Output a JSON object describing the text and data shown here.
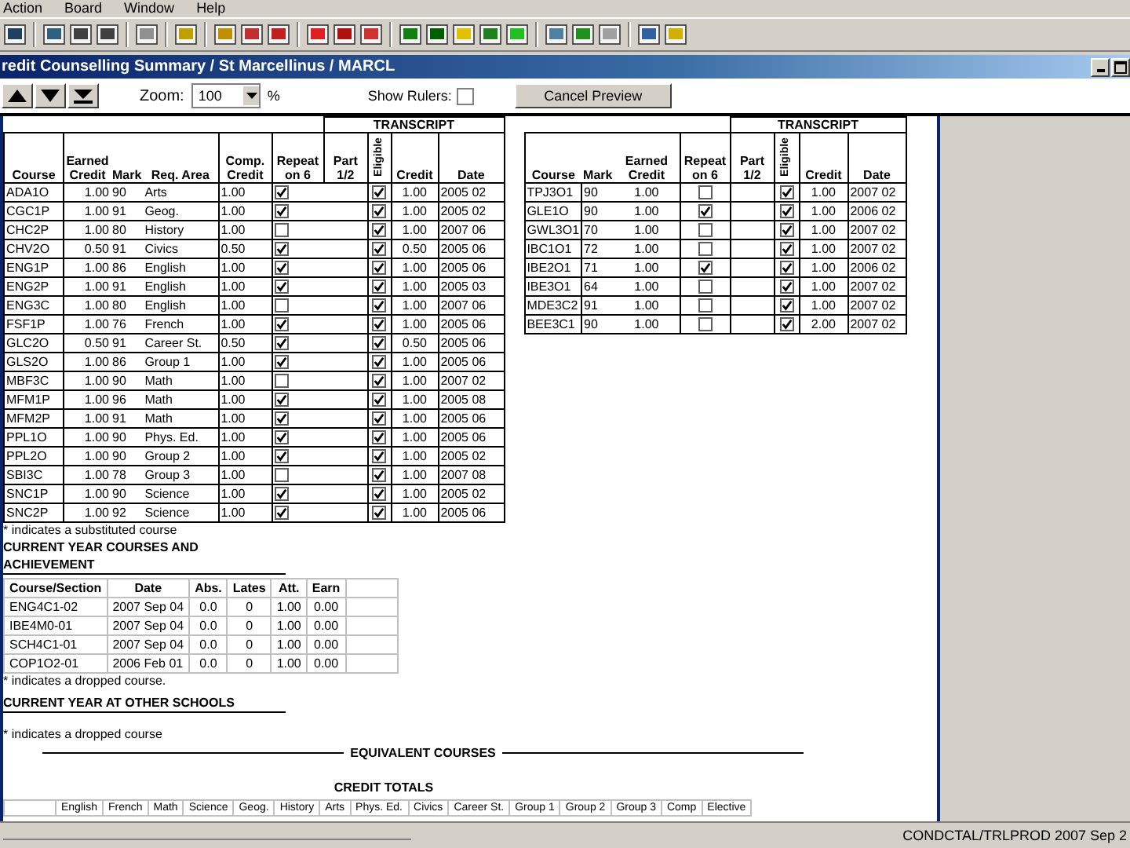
{
  "menu": [
    "Action",
    "Board",
    "Window",
    "Help"
  ],
  "window": {
    "title": "redit Counselling Summary  / St Marcellinus / MARCL"
  },
  "preview_toolbar": {
    "zoom_label": "Zoom:",
    "zoom_value": "100",
    "zoom_unit": "%",
    "show_rulers_label": "Show Rulers:",
    "show_rulers_checked": false,
    "cancel_button": "Cancel Preview"
  },
  "transcript_left": {
    "group_label": "TRANSCRIPT",
    "columns": [
      "Course",
      "Earned Credit",
      "Mark",
      "Req. Area",
      "Comp. Credit",
      "Repeat on 6",
      "Part 1/2",
      "Eligible",
      "Credit",
      "Date"
    ],
    "rows": [
      {
        "course": "ADA1O",
        "earned_credit": "1.00",
        "mark": "90",
        "req_area": "Arts",
        "comp_credit": "1.00",
        "repeat_on_6": true,
        "eligible": true,
        "credit": "1.00",
        "date": "2005 02"
      },
      {
        "course": "CGC1P",
        "earned_credit": "1.00",
        "mark": "91",
        "req_area": "Geog.",
        "comp_credit": "1.00",
        "repeat_on_6": true,
        "eligible": true,
        "credit": "1.00",
        "date": "2005 02"
      },
      {
        "course": "CHC2P",
        "earned_credit": "1.00",
        "mark": "80",
        "req_area": "History",
        "comp_credit": "1.00",
        "repeat_on_6": false,
        "eligible": true,
        "credit": "1.00",
        "date": "2007 06"
      },
      {
        "course": "CHV2O",
        "earned_credit": "0.50",
        "mark": "91",
        "req_area": "Civics",
        "comp_credit": "0.50",
        "repeat_on_6": true,
        "eligible": true,
        "credit": "0.50",
        "date": "2005 06"
      },
      {
        "course": "ENG1P",
        "earned_credit": "1.00",
        "mark": "86",
        "req_area": "English",
        "comp_credit": "1.00",
        "repeat_on_6": true,
        "eligible": true,
        "credit": "1.00",
        "date": "2005 06"
      },
      {
        "course": "ENG2P",
        "earned_credit": "1.00",
        "mark": "91",
        "req_area": "English",
        "comp_credit": "1.00",
        "repeat_on_6": true,
        "eligible": true,
        "credit": "1.00",
        "date": "2005 03"
      },
      {
        "course": "ENG3C",
        "earned_credit": "1.00",
        "mark": "80",
        "req_area": "English",
        "comp_credit": "1.00",
        "repeat_on_6": false,
        "eligible": true,
        "credit": "1.00",
        "date": "2007 06"
      },
      {
        "course": "FSF1P",
        "earned_credit": "1.00",
        "mark": "76",
        "req_area": "French",
        "comp_credit": "1.00",
        "repeat_on_6": true,
        "eligible": true,
        "credit": "1.00",
        "date": "2005 06"
      },
      {
        "course": "GLC2O",
        "earned_credit": "0.50",
        "mark": "91",
        "req_area": "Career St.",
        "comp_credit": "0.50",
        "repeat_on_6": true,
        "eligible": true,
        "credit": "0.50",
        "date": "2005 06"
      },
      {
        "course": "GLS2O",
        "earned_credit": "1.00",
        "mark": "86",
        "req_area": "Group 1",
        "comp_credit": "1.00",
        "repeat_on_6": true,
        "eligible": true,
        "credit": "1.00",
        "date": "2005 06"
      },
      {
        "course": "MBF3C",
        "earned_credit": "1.00",
        "mark": "90",
        "req_area": "Math",
        "comp_credit": "1.00",
        "repeat_on_6": false,
        "eligible": true,
        "credit": "1.00",
        "date": "2007 02"
      },
      {
        "course": "MFM1P",
        "earned_credit": "1.00",
        "mark": "96",
        "req_area": "Math",
        "comp_credit": "1.00",
        "repeat_on_6": true,
        "eligible": true,
        "credit": "1.00",
        "date": "2005 08"
      },
      {
        "course": "MFM2P",
        "earned_credit": "1.00",
        "mark": "91",
        "req_area": "Math",
        "comp_credit": "1.00",
        "repeat_on_6": true,
        "eligible": true,
        "credit": "1.00",
        "date": "2005 06"
      },
      {
        "course": "PPL1O",
        "earned_credit": "1.00",
        "mark": "90",
        "req_area": "Phys. Ed.",
        "comp_credit": "1.00",
        "repeat_on_6": true,
        "eligible": true,
        "credit": "1.00",
        "date": "2005 06"
      },
      {
        "course": "PPL2O",
        "earned_credit": "1.00",
        "mark": "90",
        "req_area": "Group 2",
        "comp_credit": "1.00",
        "repeat_on_6": true,
        "eligible": true,
        "credit": "1.00",
        "date": "2005 02"
      },
      {
        "course": "SBI3C",
        "earned_credit": "1.00",
        "mark": "78",
        "req_area": "Group 3",
        "comp_credit": "1.00",
        "repeat_on_6": false,
        "eligible": true,
        "credit": "1.00",
        "date": "2007 08"
      },
      {
        "course": "SNC1P",
        "earned_credit": "1.00",
        "mark": "90",
        "req_area": "Science",
        "comp_credit": "1.00",
        "repeat_on_6": true,
        "eligible": true,
        "credit": "1.00",
        "date": "2005 02"
      },
      {
        "course": "SNC2P",
        "earned_credit": "1.00",
        "mark": "92",
        "req_area": "Science",
        "comp_credit": "1.00",
        "repeat_on_6": true,
        "eligible": true,
        "credit": "1.00",
        "date": "2005 06"
      }
    ]
  },
  "transcript_right": {
    "group_label": "TRANSCRIPT",
    "columns": [
      "Course",
      "Mark",
      "Earned Credit",
      "Repeat on 6",
      "Part 1/2",
      "Eligible",
      "Credit",
      "Date"
    ],
    "rows": [
      {
        "course": "TPJ3O1",
        "mark": "90",
        "earned_credit": "1.00",
        "repeat_on_6": false,
        "eligible": true,
        "credit": "1.00",
        "date": "2007 02"
      },
      {
        "course": "GLE1O",
        "mark": "90",
        "earned_credit": "1.00",
        "repeat_on_6": true,
        "eligible": true,
        "credit": "1.00",
        "date": "2006 02"
      },
      {
        "course": "GWL3O1",
        "mark": "70",
        "earned_credit": "1.00",
        "repeat_on_6": false,
        "eligible": true,
        "credit": "1.00",
        "date": "2007 02"
      },
      {
        "course": "IBC1O1",
        "mark": "72",
        "earned_credit": "1.00",
        "repeat_on_6": false,
        "eligible": true,
        "credit": "1.00",
        "date": "2007 02"
      },
      {
        "course": "IBE2O1",
        "mark": "71",
        "earned_credit": "1.00",
        "repeat_on_6": true,
        "eligible": true,
        "credit": "1.00",
        "date": "2006 02"
      },
      {
        "course": "IBE3O1",
        "mark": "64",
        "earned_credit": "1.00",
        "repeat_on_6": false,
        "eligible": true,
        "credit": "1.00",
        "date": "2007 02"
      },
      {
        "course": "MDE3C2",
        "mark": "91",
        "earned_credit": "1.00",
        "repeat_on_6": false,
        "eligible": true,
        "credit": "1.00",
        "date": "2007 02"
      },
      {
        "course": "BEE3C1",
        "mark": "90",
        "earned_credit": "1.00",
        "repeat_on_6": false,
        "eligible": true,
        "credit": "2.00",
        "date": "2007 02"
      }
    ]
  },
  "substitute_note": "* indicates a substituted course",
  "current_year": {
    "title": "CURRENT YEAR COURSES AND ACHIEVEMENT",
    "columns": [
      "Course/Section",
      "Date",
      "Abs.",
      "Lates",
      "Att.",
      "Earn"
    ],
    "rows": [
      [
        "ENG4C1-02",
        "2007 Sep 04",
        "0.0",
        "0",
        "1.00",
        "0.00"
      ],
      [
        "IBE4M0-01",
        "2007 Sep 04",
        "0.0",
        "0",
        "1.00",
        "0.00"
      ],
      [
        "SCH4C1-01",
        "2007 Sep 04",
        "0.0",
        "0",
        "1.00",
        "0.00"
      ],
      [
        "COP1O2-01",
        "2006 Feb 01",
        "0.0",
        "0",
        "1.00",
        "0.00"
      ]
    ],
    "note": "* indicates a dropped course."
  },
  "other_schools": {
    "title": "CURRENT YEAR AT OTHER SCHOOLS",
    "note": "* indicates a dropped course"
  },
  "equivalent_courses": {
    "title": "EQUIVALENT COURSES"
  },
  "credit_totals": {
    "title": "CREDIT TOTALS",
    "columns": [
      "English",
      "French",
      "Math",
      "Science",
      "Geog.",
      "History",
      "Arts",
      "Phys. Ed.",
      "Civics",
      "Career St.",
      "Group 1",
      "Group 2",
      "Group 3",
      "Comp",
      "Elective"
    ]
  },
  "status_bar": {
    "text": "CONDCTAL/TRLPROD  2007 Sep 2"
  }
}
